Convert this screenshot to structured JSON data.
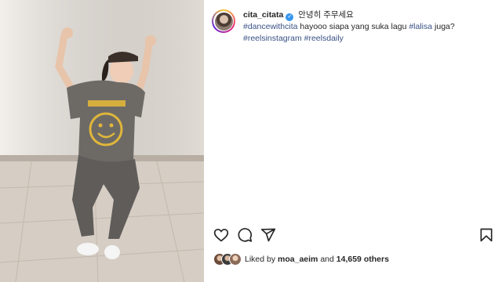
{
  "post": {
    "username": "cita_citata",
    "verified": true,
    "verified_glyph": "✓",
    "caption_korean": "안녕히 주무세요",
    "caption_segments": [
      {
        "type": "hashtag",
        "text": "#dancewithcita"
      },
      {
        "type": "plain",
        "text": " hayooo siapa yang suka lagu "
      },
      {
        "type": "hashtag",
        "text": "#lalisa"
      },
      {
        "type": "plain",
        "text": " juga?"
      }
    ],
    "hashtags_line2": [
      "#reelsinstagram",
      "#reelsdaily"
    ]
  },
  "actions": {
    "like_icon": "heart-icon",
    "comment_icon": "comment-icon",
    "share_icon": "share-icon",
    "save_icon": "bookmark-icon"
  },
  "likes": {
    "prefix": "Liked by",
    "user": "moa_aeim",
    "conjunction": "and",
    "count": "14,659 others"
  },
  "colors": {
    "hashtag": "#385185",
    "text": "#262626",
    "verified": "#3897f0"
  }
}
